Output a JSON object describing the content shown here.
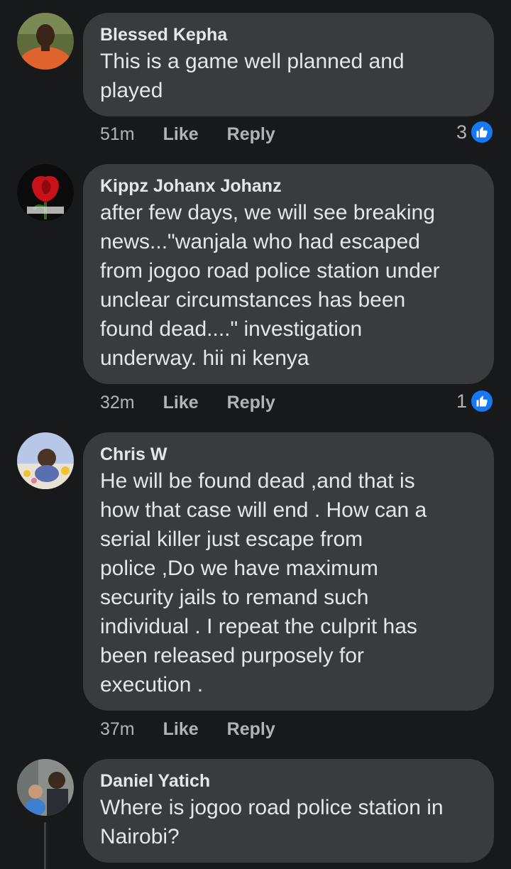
{
  "comments": [
    {
      "author": "Blessed Kepha",
      "text": "This is a game well planned and\nplayed",
      "time": "51m",
      "like_label": "Like",
      "reply_label": "Reply",
      "reaction_count": "3"
    },
    {
      "author": "Kippz Johanx Johanz",
      "text": "after few days, we will see breaking\nnews...\"wanjala who had escaped\nfrom jogoo road police station under\nunclear circumstances has been\nfound dead....\" investigation\nunderway. hii ni kenya",
      "time": "32m",
      "like_label": "Like",
      "reply_label": "Reply",
      "reaction_count": "1"
    },
    {
      "author": "Chris W",
      "text": "He will be found dead ,and that is\nhow that case will end . How can a\nserial killer just escape from\npolice ,Do we have maximum\nsecurity jails to remand such\nindividual . I repeat the culprit has\nbeen released purposely for\nexecution .",
      "time": "37m",
      "like_label": "Like",
      "reply_label": "Reply"
    },
    {
      "author": "Daniel Yatich",
      "text": "Where is jogoo road police station in\nNairobi?"
    }
  ],
  "colors": {
    "background": "#18191a",
    "bubble": "#3a3b3c",
    "text_primary": "#e4e6eb",
    "text_secondary": "#b0b3b8",
    "like_blue": "#1877f2"
  },
  "icons": {
    "reaction": "like-thumbs-up-icon"
  }
}
